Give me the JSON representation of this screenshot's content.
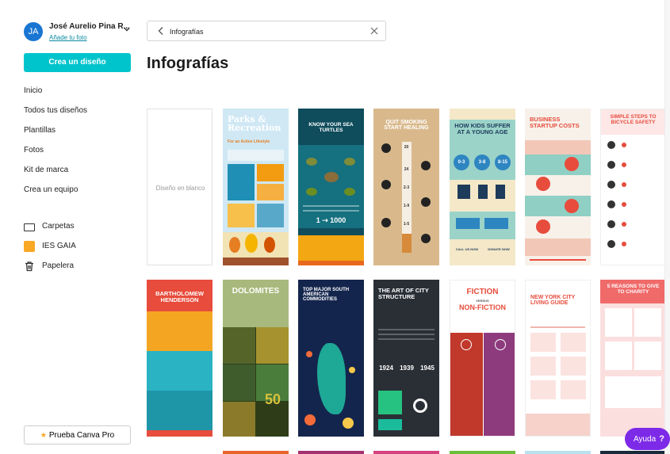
{
  "account": {
    "initials": "JA",
    "name": "José Aurelio Pina R...",
    "add_photo": "Añade tu foto"
  },
  "sidebar": {
    "create_button": "Crea un diseño",
    "nav": [
      {
        "label": "Inicio"
      },
      {
        "label": "Todos tus diseños"
      },
      {
        "label": "Plantillas"
      },
      {
        "label": "Fotos"
      },
      {
        "label": "Kit de marca"
      },
      {
        "label": "Crea un equipo"
      }
    ],
    "folders": [
      {
        "label": "Carpetas",
        "icon": "folder-icon"
      },
      {
        "label": "IES GAIA",
        "icon": "team-square-icon"
      },
      {
        "label": "Papelera",
        "icon": "trash-icon"
      }
    ],
    "pro_button": "Prueba Canva Pro"
  },
  "search": {
    "value": "Infografías"
  },
  "page": {
    "title": "Infografías",
    "blank_label": "Diseño en blanco"
  },
  "templates_row1": [
    {
      "title": "Parks & Recreation",
      "subtitle": "For an Active Lifestyle"
    },
    {
      "title": "KNOW YOUR SEA TURTLES",
      "footer": "1 ⇢ 1000"
    },
    {
      "title": "QUIT SMOKING START HEALING",
      "numbers": [
        "20",
        "24",
        "2-3",
        "1-9",
        "1-5"
      ]
    },
    {
      "title": "HOW KIDS SUFFER AT A YOUNG AGE",
      "badges": [
        "0-3",
        "3-8",
        "8-15"
      ],
      "buttons": [
        "CALL US NOW",
        "DONATE NOW"
      ]
    },
    {
      "title": "BUSINESS STARTUP COSTS"
    },
    {
      "title": "SIMPLE STEPS TO BICYCLE SAFETY"
    }
  ],
  "templates_row2": [
    {
      "title": "BARTHOLOMEW HENDERSON"
    },
    {
      "title": "DOLOMITES",
      "number": "50"
    },
    {
      "title": "TOP MAJOR SOUTH AMERICAN COMMODITIES"
    },
    {
      "title": "THE ART OF CITY STRUCTURE",
      "years": [
        "1924",
        "1939",
        "1945"
      ]
    },
    {
      "title": "FICTION",
      "versus": "VERSUS",
      "subtitle": "NON-FICTION"
    },
    {
      "title": "NEW YORK CITY LIVING GUIDE"
    },
    {
      "title": "5 REASONS TO GIVE TO CHARITY"
    }
  ],
  "help": {
    "label": "Ayuda",
    "symbol": "?"
  },
  "colors": {
    "accent": "#00c4cc",
    "help": "#7d2ae8",
    "avatar": "#1976d2"
  }
}
